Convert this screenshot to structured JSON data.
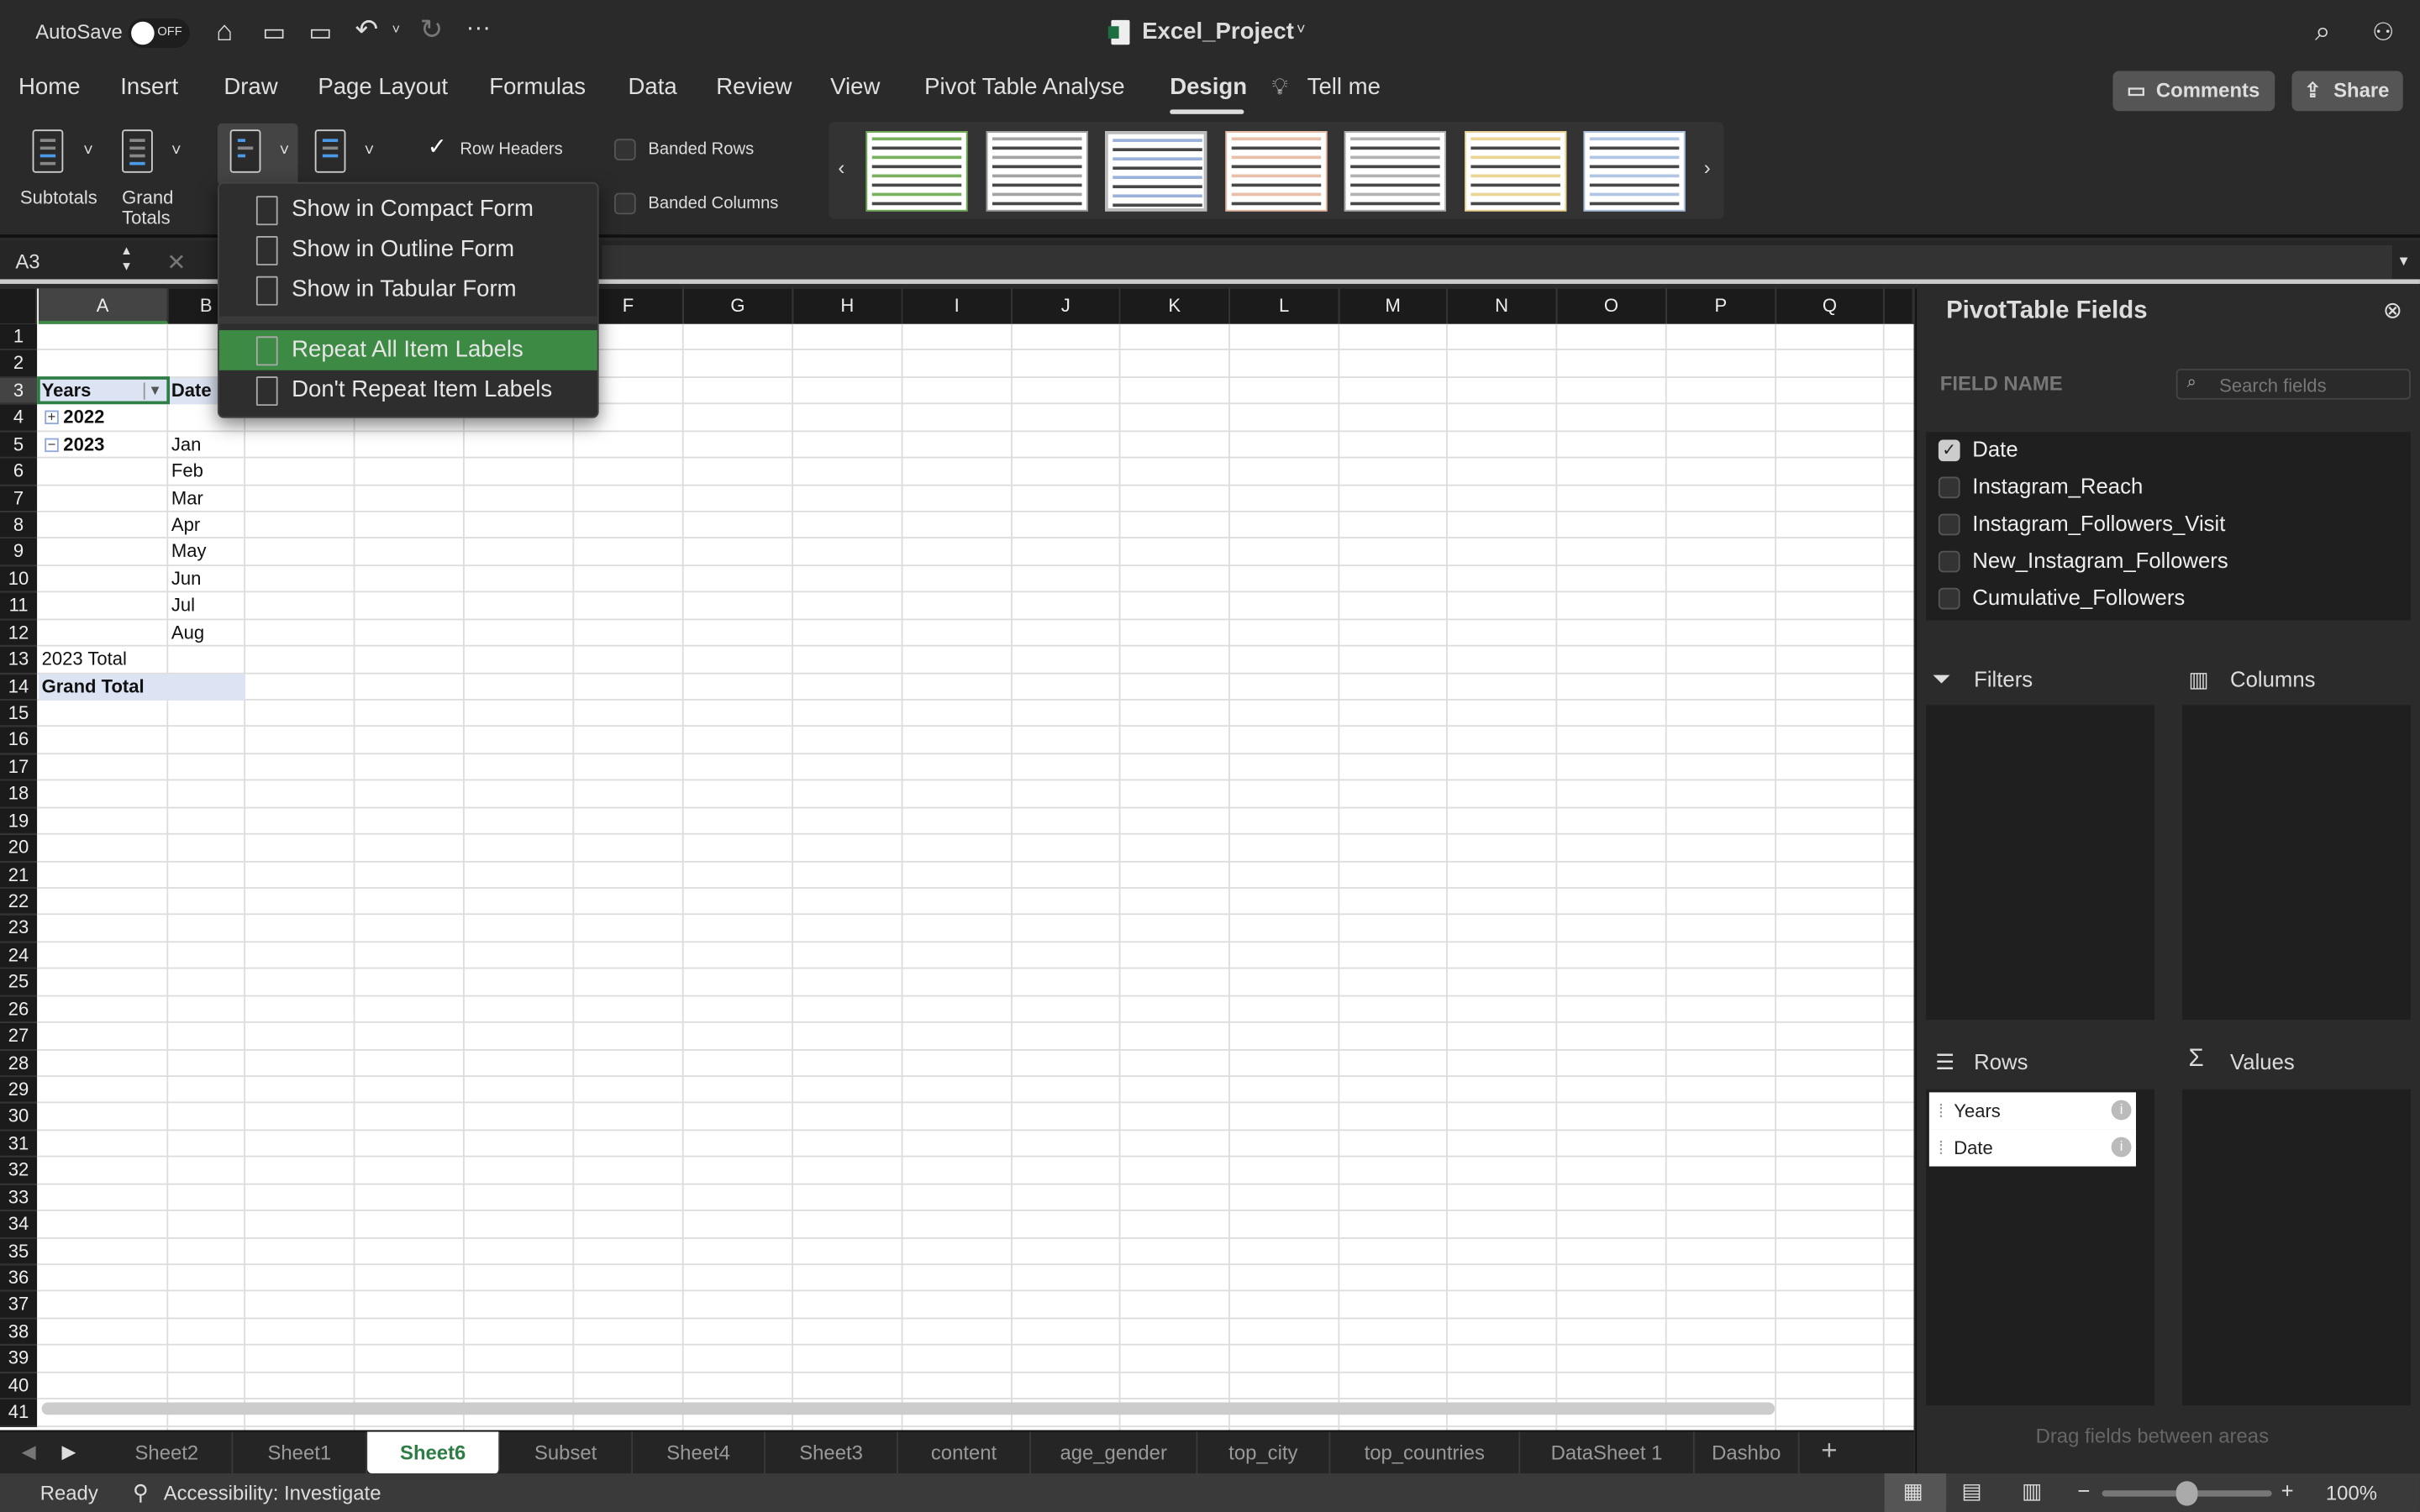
{
  "titlebar": {
    "autosave": "AutoSave",
    "toggle": "OFF",
    "title": "Excel_Project"
  },
  "tabs": [
    "Home",
    "Insert",
    "Draw",
    "Page Layout",
    "Formulas",
    "Data",
    "Review",
    "View",
    "Pivot Table Analyse",
    "Design"
  ],
  "active_tab": "Design",
  "tell_me": "Tell me",
  "comments": "Comments",
  "share": "Share",
  "ribbon": {
    "subtotals": "Subtotals",
    "grand": "Grand",
    "totals": "Totals",
    "row_headers": "Row Headers",
    "banded_rows": "Banded Rows",
    "banded_columns": "Banded Columns",
    "row_headers_checked": true
  },
  "styles": [
    {
      "color": "#6aa84f"
    },
    {
      "color": "#999999"
    },
    {
      "color": "#8fa8d8"
    },
    {
      "color": "#e8b8a0"
    },
    {
      "color": "#aaaaaa"
    },
    {
      "color": "#e8d08a"
    },
    {
      "color": "#a8c0e0"
    }
  ],
  "namebox": "A3",
  "menu": {
    "items": [
      "Show in Compact Form",
      "Show in Outline Form",
      "Show in Tabular Form",
      "Repeat All Item Labels",
      "Don't Repeat Item Labels"
    ],
    "highlighted": "Repeat All Item Labels",
    "highlight_color": "#3c8a44"
  },
  "columns": [
    "A",
    "B",
    "C",
    "D",
    "E",
    "F",
    "G",
    "H",
    "I",
    "J",
    "K",
    "L",
    "M",
    "N",
    "O",
    "P",
    "Q"
  ],
  "rows": [
    "1",
    "2",
    "3",
    "4",
    "5",
    "6",
    "7",
    "8",
    "9",
    "10",
    "11",
    "12",
    "13",
    "14",
    "15",
    "16",
    "17",
    "18",
    "19",
    "20",
    "21",
    "22",
    "23",
    "24",
    "25",
    "26",
    "27",
    "28",
    "29",
    "30",
    "31",
    "32",
    "33",
    "34",
    "35",
    "36",
    "37",
    "38",
    "39",
    "40",
    "41"
  ],
  "pivot": {
    "h_years": "Years",
    "h_date": "Date",
    "y2022": "2022",
    "y2023": "2023",
    "months": [
      "Jan",
      "Feb",
      "Mar",
      "Apr",
      "May",
      "Jun",
      "Jul",
      "Aug"
    ],
    "total2023": "2023 Total",
    "grand": "Grand Total"
  },
  "sheets": [
    "Sheet2",
    "Sheet1",
    "Sheet6",
    "Subset",
    "Sheet4",
    "Sheet3",
    "content",
    "age_gender",
    "top_city",
    "top_countries",
    "DataSheet 1",
    "Dashbo"
  ],
  "active_sheet": "Sheet6",
  "status": {
    "ready": "Ready",
    "accessibility": "Accessibility: Investigate",
    "zoom": "100%"
  },
  "pane": {
    "title": "PivotTable Fields",
    "field_name": "FIELD NAME",
    "search_placeholder": "Search fields",
    "fields": [
      {
        "name": "Date",
        "checked": true
      },
      {
        "name": "Instagram_Reach",
        "checked": false
      },
      {
        "name": "Instagram_Followers_Visit",
        "checked": false
      },
      {
        "name": "New_Instagram_Followers",
        "checked": false
      },
      {
        "name": "Cumulative_Followers",
        "checked": false
      }
    ],
    "filters": "Filters",
    "columns": "Columns",
    "rows": "Rows",
    "values": "Values",
    "row_items": [
      "Years",
      "Date"
    ],
    "hint": "Drag fields between areas"
  }
}
